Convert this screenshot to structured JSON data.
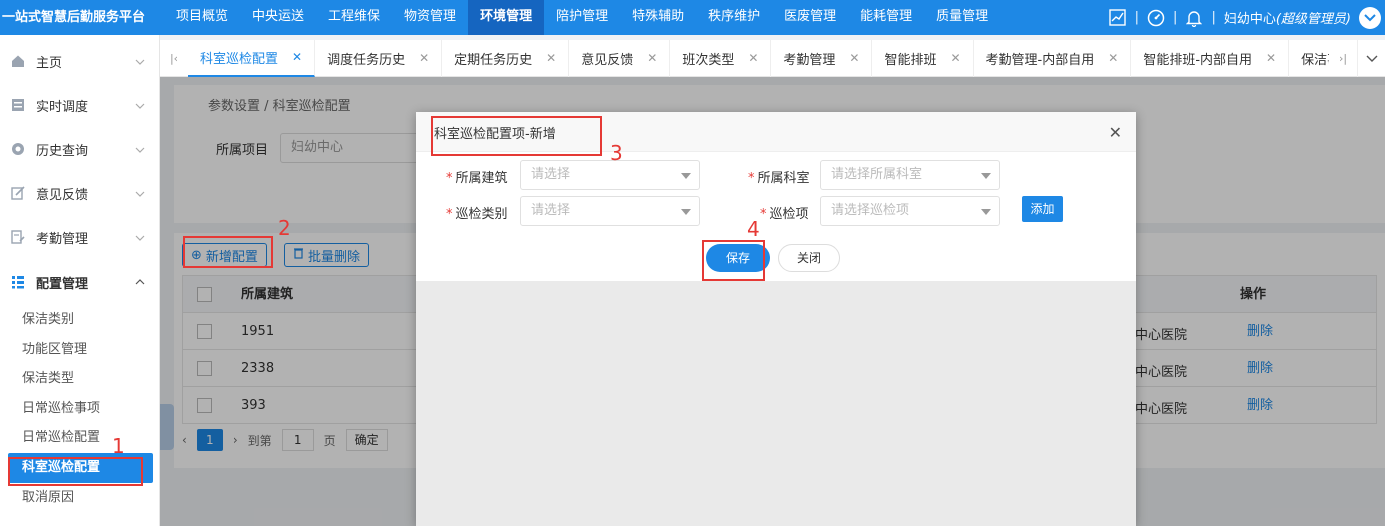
{
  "app": {
    "brand": "一站式智慧后勤服务平台"
  },
  "topnav": {
    "items": [
      "项目概览",
      "中央运送",
      "工程维保",
      "物资管理",
      "环境管理",
      "陪护管理",
      "特殊辅助",
      "秩序维护",
      "医废管理",
      "能耗管理",
      "质量管理"
    ],
    "active": "环境管理"
  },
  "user": {
    "name_prefix": "妇幼中心",
    "role": "(超级管理员)"
  },
  "sidebar": {
    "groups": [
      {
        "label": "主页",
        "icon": "home-icon"
      },
      {
        "label": "实时调度",
        "icon": "dispatch-icon"
      },
      {
        "label": "历史查询",
        "icon": "history-icon"
      },
      {
        "label": "意见反馈",
        "icon": "feedback-icon"
      },
      {
        "label": "考勤管理",
        "icon": "attendance-icon"
      }
    ],
    "open_group": {
      "label": "配置管理",
      "icon": "config-icon"
    },
    "sub_items": [
      "保洁类别",
      "功能区管理",
      "保洁类型",
      "日常巡检事项",
      "日常巡检配置",
      "科室巡检配置",
      "取消原因"
    ],
    "active_sub": "科室巡检配置"
  },
  "tabs": {
    "items": [
      "科室巡检配置",
      "调度任务历史",
      "定期任务历史",
      "意见反馈",
      "班次类型",
      "考勤管理",
      "智能排班",
      "考勤管理-内部自用",
      "智能排班-内部自用",
      "保洁事项"
    ],
    "active": "科室巡检配置"
  },
  "page": {
    "breadcrumb": "参数设置 / 科室巡检配置",
    "filter_label": "所属项目",
    "filter_value": "妇幼中心",
    "add_button": "新增配置",
    "batch_delete_button": "批量删除",
    "table": {
      "col_building": "所属建筑",
      "col_action": "操作",
      "rows": [
        {
          "building": "1951",
          "hospital": "中心医院",
          "action": "删除"
        },
        {
          "building": "2338",
          "hospital": "中心医院",
          "action": "删除"
        },
        {
          "building": "393",
          "hospital": "中心医院",
          "action": "删除"
        }
      ]
    },
    "pager": {
      "current": "1",
      "goto_label": "到第",
      "goto_value": "1",
      "page_unit": "页",
      "confirm": "确定"
    }
  },
  "modal": {
    "title": "科室巡检配置项-新增",
    "fields": {
      "building_label": "所属建筑",
      "building_placeholder": "请选择",
      "dept_label": "所属科室",
      "dept_placeholder": "请选择所属科室",
      "category_label": "巡检类别",
      "category_placeholder": "请选择",
      "item_label": "巡检项",
      "item_placeholder": "请选择巡检项"
    },
    "add_button": "添加",
    "save_button": "保存",
    "close_button": "关闭"
  },
  "annotations": [
    "1",
    "2",
    "3",
    "4"
  ],
  "colors": {
    "primary": "#1e88e5",
    "annotation": "#e53935"
  }
}
